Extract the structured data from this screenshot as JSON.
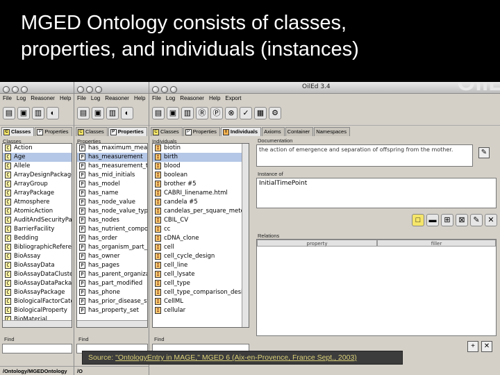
{
  "slide": {
    "title_line1": "MGED Ontology consists of classes,",
    "title_line2": "properties, and individuals (instances)"
  },
  "window": {
    "title": "OilEd 3.4",
    "bg_text": "OilE"
  },
  "menus": {
    "win1": [
      "File",
      "Log",
      "Reasoner",
      "Help"
    ],
    "win2": [
      "File",
      "Log",
      "Reasoner",
      "Help"
    ],
    "win3": [
      "File",
      "Log",
      "Reasoner",
      "Help",
      "Export"
    ]
  },
  "tabs": {
    "win1": [
      "Classes",
      "Properties"
    ],
    "win2": [
      "Classes",
      "Properties"
    ],
    "win3": [
      "Classes",
      "Properties",
      "Individuals",
      "Axioms",
      "Container",
      "Namespaces"
    ]
  },
  "classes_panel": {
    "label": "Classes",
    "items": [
      "Action",
      "Age",
      "Allele",
      "ArrayDesignPackage",
      "ArrayGroup",
      "ArrayPackage",
      "Atmosphere",
      "AtomicAction",
      "AuditAndSecurityPackage",
      "BarrierFacility",
      "Bedding",
      "BibliographicReference",
      "BioAssay",
      "BioAssayData",
      "BioAssayDataCluster",
      "BioAssayDataPackage",
      "BioAssayPackage",
      "BiologicalFactorCategory",
      "BiologicalProperty",
      "BioMaterial"
    ],
    "selected": 1,
    "find_label": "Find",
    "status": "/Ontology/MGEDOntology"
  },
  "properties_panel": {
    "label": "Properties",
    "items": [
      "has_maximum_measurement",
      "has_measurement",
      "has_measurement_type",
      "has_mid_initials",
      "has_model",
      "has_name",
      "has_node_value",
      "has_node_value_type",
      "has_nodes",
      "has_nutrient_component",
      "has_order",
      "has_organism_part_age",
      "has_owner",
      "has_pages",
      "has_parent_organization",
      "has_part_modified",
      "has_phone",
      "has_prior_disease_state",
      "has_property_set"
    ],
    "selected": 1,
    "find_label": "Find",
    "status": "/O"
  },
  "individuals_panel": {
    "label": "Individuals",
    "items": [
      "biotin",
      "birth",
      "blood",
      "boolean",
      "brother #5",
      "CABRI_linename.html",
      "candela #5",
      "candelas_per_square_meter",
      "CBIL_CV",
      "cc",
      "cDNA_clone",
      "cell",
      "cell_cycle_design",
      "cell_line",
      "cell_lysate",
      "cell_type",
      "cell_type_comparison_design",
      "CellML",
      "cellular"
    ],
    "selected": 1,
    "find_label": "Find"
  },
  "detail": {
    "documentation_label": "Documentation",
    "documentation_text": "the action of emergence and separation of offspring from the mother.",
    "instance_of_label": "Instance of",
    "instance_of_value": "InitialTimePoint",
    "relations_label": "Relations",
    "col_property": "property",
    "col_filler": "filler"
  },
  "caption": {
    "prefix": "Source: ",
    "link": "\"OntologyEntry in MAGE,\" MGED 6 (Aix-en-Provence, France Sept., 2003)"
  },
  "colors": {
    "slide_bg": "#000000",
    "title_text": "#ffffff",
    "selection": "#b5c7e6",
    "caption_text": "#dcd27a",
    "window_bg": "#d4d0c8"
  }
}
